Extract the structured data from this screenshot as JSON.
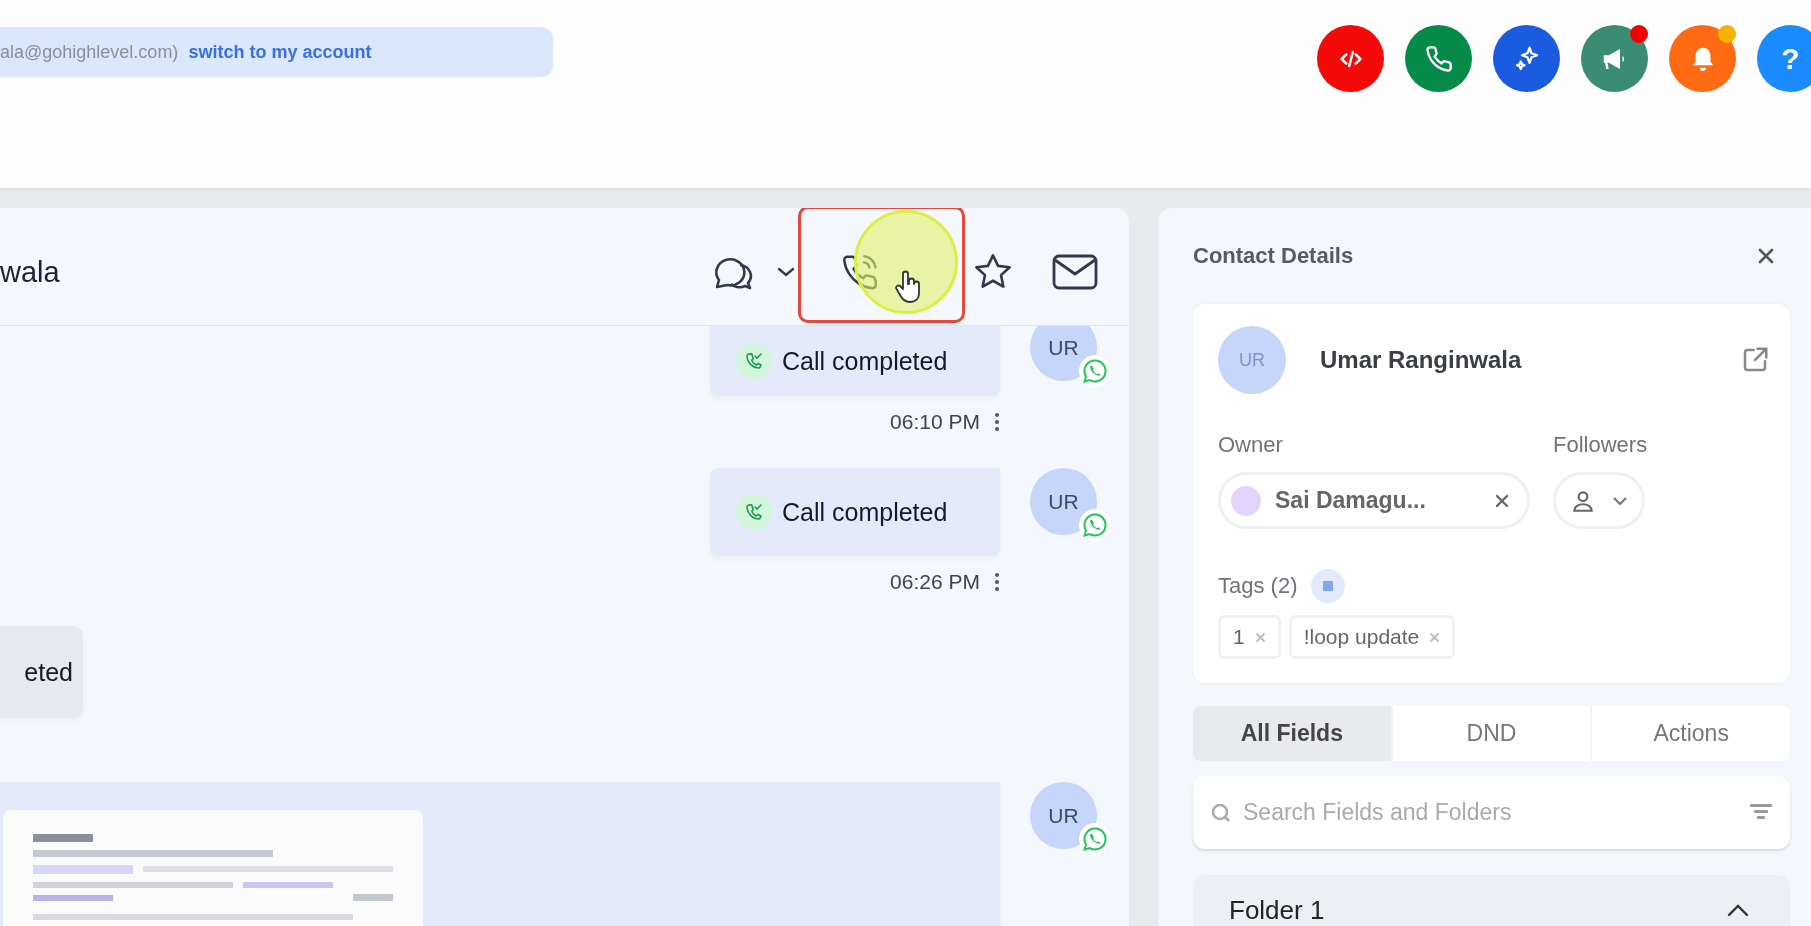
{
  "banner": {
    "text": "ala@gohighlevel.com)",
    "link": "switch to my account"
  },
  "header_actions": [
    {
      "kind": "code",
      "color": "#f50a0a"
    },
    {
      "kind": "phone",
      "color": "#058a4a"
    },
    {
      "kind": "sparkle",
      "color": "#1a5be0"
    },
    {
      "kind": "megaphone",
      "color": "#3a8c73",
      "badge": {
        "color": "#f00000"
      }
    },
    {
      "kind": "bell",
      "color": "#ff6a13",
      "badge": {
        "color": "#f5b400"
      }
    },
    {
      "kind": "help",
      "color": "#1a8cff",
      "label": "?"
    }
  ],
  "conversation": {
    "title": "wala",
    "toolbar": [
      {
        "kind": "chat",
        "highlighted": false
      },
      {
        "kind": "caret",
        "highlighted": false
      },
      {
        "kind": "phone",
        "highlighted": true
      },
      {
        "kind": "star",
        "highlighted": false
      },
      {
        "kind": "mail",
        "highlighted": false
      }
    ]
  },
  "messages": [
    {
      "kind": "call",
      "right_aligned": true,
      "text": "Call completed",
      "time": "06:10 PM",
      "avatar": "UR"
    },
    {
      "kind": "call",
      "right_aligned": true,
      "text": "Call completed",
      "time": "06:26 PM",
      "avatar": "UR"
    },
    {
      "kind": "text",
      "right_aligned": false,
      "text": "eted"
    },
    {
      "right_aligned": true,
      "avatar": "UR"
    }
  ],
  "contact_panel": {
    "title": "Contact Details",
    "contact": {
      "initials": "UR",
      "name": "Umar Ranginwala"
    },
    "owner": {
      "label": "Owner",
      "name": "Sai Damagu..."
    },
    "followers": {
      "label": "Followers"
    },
    "tags": {
      "label": "Tags (2)",
      "items": [
        "1",
        "!loop update"
      ]
    },
    "tabs": [
      {
        "label": "All Fields",
        "selected": true
      },
      {
        "label": "DND",
        "selected": false
      },
      {
        "label": "Actions",
        "selected": false
      }
    ],
    "search": {
      "placeholder": "Search Fields and Folders"
    },
    "folders": [
      {
        "name": "Folder 1",
        "expanded": true
      }
    ]
  }
}
